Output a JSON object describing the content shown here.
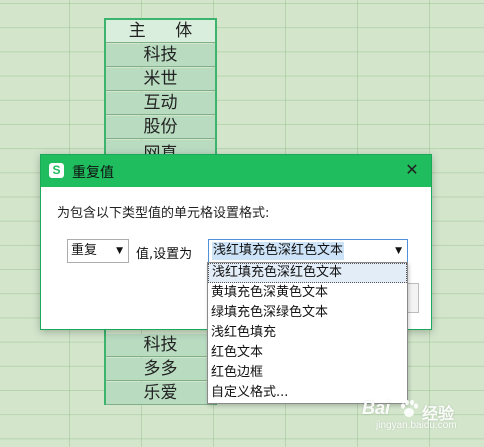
{
  "sheet": {
    "header": "主 体",
    "cells_top": [
      "科技",
      "米世",
      "互动",
      "股份"
    ],
    "cell_partial": "网真",
    "cells_bottom": [
      "科技",
      "多多",
      "乐爱"
    ]
  },
  "dialog": {
    "title": "重复值",
    "description": "为包含以下类型值的单元格设置格式:",
    "rule_value": "重复",
    "set_label": "值,设置为",
    "format_value": "浅红填充色深红色文本",
    "close_symbol": "✕",
    "app_icon_letter": "S"
  },
  "dropdown": {
    "options": [
      "浅红填充色深红色文本",
      "黄填充色深黄色文本",
      "绿填充色深绿色文本",
      "浅红色填充",
      "红色文本",
      "红色边框",
      "自定义格式..."
    ]
  },
  "watermark": {
    "main": "Bai",
    "brand": "经验",
    "url": "jingyan.baidu.com"
  },
  "colors": {
    "accent": "#1fbd5e",
    "selection": "#cde3f7"
  }
}
